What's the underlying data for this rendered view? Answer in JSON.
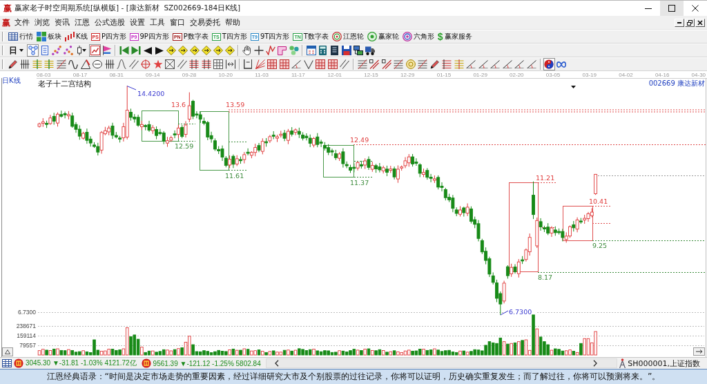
{
  "window": {
    "logo": "赢",
    "title": "赢家老子时空周期系统[纵横版] - [康达新材  SZ002669-184日K线]",
    "controls": [
      {
        "kind": "minimize",
        "hovered": false
      },
      {
        "kind": "maximize",
        "hovered": true
      },
      {
        "kind": "close",
        "hovered": false
      }
    ]
  },
  "menu_bar": {
    "logo": "赢",
    "items": [
      "文件",
      "浏览",
      "资讯",
      "江恩",
      "公式选股",
      "设置",
      "工具",
      "窗口",
      "交易委托",
      "帮助"
    ],
    "document_controls": [
      {
        "kind": "minimize"
      },
      {
        "kind": "restore"
      },
      {
        "kind": "close"
      }
    ]
  },
  "toolbar_1": [
    {
      "kind": "table",
      "label": "行情"
    },
    {
      "kind": "blocks",
      "label": "板块"
    },
    {
      "kind": "bars",
      "label": "K线"
    },
    {
      "kind": "badge",
      "badge": "PS",
      "color": "#d02828",
      "label": "P四方形"
    },
    {
      "kind": "badge",
      "badge": "P9",
      "color": "#c028c0",
      "label": "9P四方形"
    },
    {
      "kind": "badge",
      "badge": "PN",
      "color": "#a01818",
      "label": "P数字表"
    },
    {
      "kind": "badge",
      "badge": "TS",
      "color": "#28a048",
      "label": "T四方形"
    },
    {
      "kind": "badge",
      "badge": "T9",
      "color": "#2888c8",
      "label": "9T四方形"
    },
    {
      "kind": "badge",
      "badge": "TN",
      "color": "#28a048",
      "label": "T数字表"
    },
    {
      "kind": "target",
      "label": "江恩轮"
    },
    {
      "kind": "ring",
      "label": "赢家轮"
    },
    {
      "kind": "rings",
      "label": "六角形"
    },
    {
      "kind": "glyph",
      "badge": "$",
      "label": "赢家服务"
    }
  ],
  "toolbar_2": {
    "period": "日",
    "buttons": [
      {
        "pressed": true
      },
      {
        "pressed": false
      },
      {
        "pressed": false
      },
      {
        "pressed": false
      },
      {
        "pressed": false
      },
      {
        "pressed": true
      },
      {
        "pressed": false
      },
      {
        "pressed": false
      },
      {
        "pressed": false
      },
      {
        "pressed": false
      },
      {
        "pressed": false
      },
      {
        "pressed": false
      },
      {
        "pressed": false
      },
      {
        "pressed": false
      },
      {
        "pressed": false
      },
      {
        "pressed": false
      },
      {
        "pressed": false
      },
      {
        "pressed": false
      },
      {
        "pressed": false
      },
      {
        "pressed": false
      },
      {
        "pressed": false
      },
      {
        "pressed": false
      },
      {
        "pressed": false
      },
      {
        "pressed": false
      },
      {
        "pressed": false
      },
      {
        "pressed": false
      },
      {
        "pressed": false
      },
      {
        "pressed": false
      }
    ]
  },
  "toolbar_3": {
    "buttons": [
      {
        "pressed": false
      },
      {
        "pressed": false
      },
      {
        "pressed": false
      },
      {
        "pressed": false
      },
      {
        "pressed": false
      },
      {
        "pressed": false
      },
      {
        "pressed": false
      },
      {
        "pressed": false
      },
      {
        "pressed": false
      },
      {
        "pressed": false
      },
      {
        "pressed": false
      },
      {
        "pressed": false
      },
      {
        "pressed": false
      },
      {
        "pressed": false
      },
      {
        "pressed": false
      },
      {
        "pressed": false
      },
      {
        "pressed": false
      },
      {
        "pressed": false
      },
      {
        "pressed": false
      },
      {
        "pressed": false
      },
      {
        "pressed": false
      },
      {
        "pressed": false
      },
      {
        "pressed": false
      },
      {
        "pressed": false
      },
      {
        "pressed": false
      },
      {
        "pressed": false
      },
      {
        "pressed": false
      },
      {
        "pressed": false
      },
      {
        "pressed": false
      },
      {
        "pressed": false
      },
      {
        "pressed": false
      },
      {
        "pressed": false
      },
      {
        "pressed": false
      },
      {
        "pressed": false
      },
      {
        "pressed": false
      },
      {
        "pressed": false
      },
      {
        "pressed": false
      },
      {
        "pressed": false
      },
      {
        "pressed": false
      },
      {
        "pressed": false
      },
      {
        "pressed": false
      },
      {
        "pressed": false
      },
      {
        "pressed": false
      },
      {
        "pressed": true
      },
      {
        "pressed": false
      }
    ]
  },
  "chart": {
    "period_label": "日K线",
    "dates": [
      "08-03",
      "08-17",
      "08-31",
      "09-14",
      "09-28",
      "10-20",
      "11-03",
      "11-17",
      "12-01",
      "12-15",
      "12-29",
      "01-15",
      "01-29",
      "02-20",
      "03-05",
      "03-19",
      "04-02",
      "04-16",
      "04-30"
    ],
    "indicator_title": "老子十二宫结构",
    "security": "002669 康达新材",
    "price_labels": [
      {
        "kind": "extreme",
        "text": "14.4200"
      },
      {
        "kind": "resistance",
        "text": "13.6"
      },
      {
        "kind": "resistance",
        "text": "13.59"
      },
      {
        "kind": "support",
        "text": "12.59"
      },
      {
        "kind": "support",
        "text": "11.61"
      },
      {
        "kind": "resistance",
        "text": "12.49"
      },
      {
        "kind": "support",
        "text": "11.37"
      },
      {
        "kind": "resistance",
        "text": "11.21"
      },
      {
        "kind": "resistance",
        "text": "10.41"
      },
      {
        "kind": "support",
        "text": "9.25"
      },
      {
        "kind": "support",
        "text": "8.17"
      },
      {
        "kind": "extreme",
        "text": "6.7300"
      }
    ],
    "axis_labels": [
      "6.7300",
      "238671",
      "159114",
      "79557"
    ]
  },
  "status_bar": {
    "quotes": [
      "3045.30 ▼-31.81 -1.03% 4121.72亿",
      "9561.39 ▼-121.12 -1.25% 5802.84"
    ],
    "index_name": "SH000001,上证指数"
  },
  "quote_bar": {
    "text": "江恩经典语录：“时间是决定市场走势的重要因素，经过详细研究大市及个别股票的过往记录，你将可以证明，历史确实重复发生；而了解过往，你将可以预测将来。”。"
  }
}
